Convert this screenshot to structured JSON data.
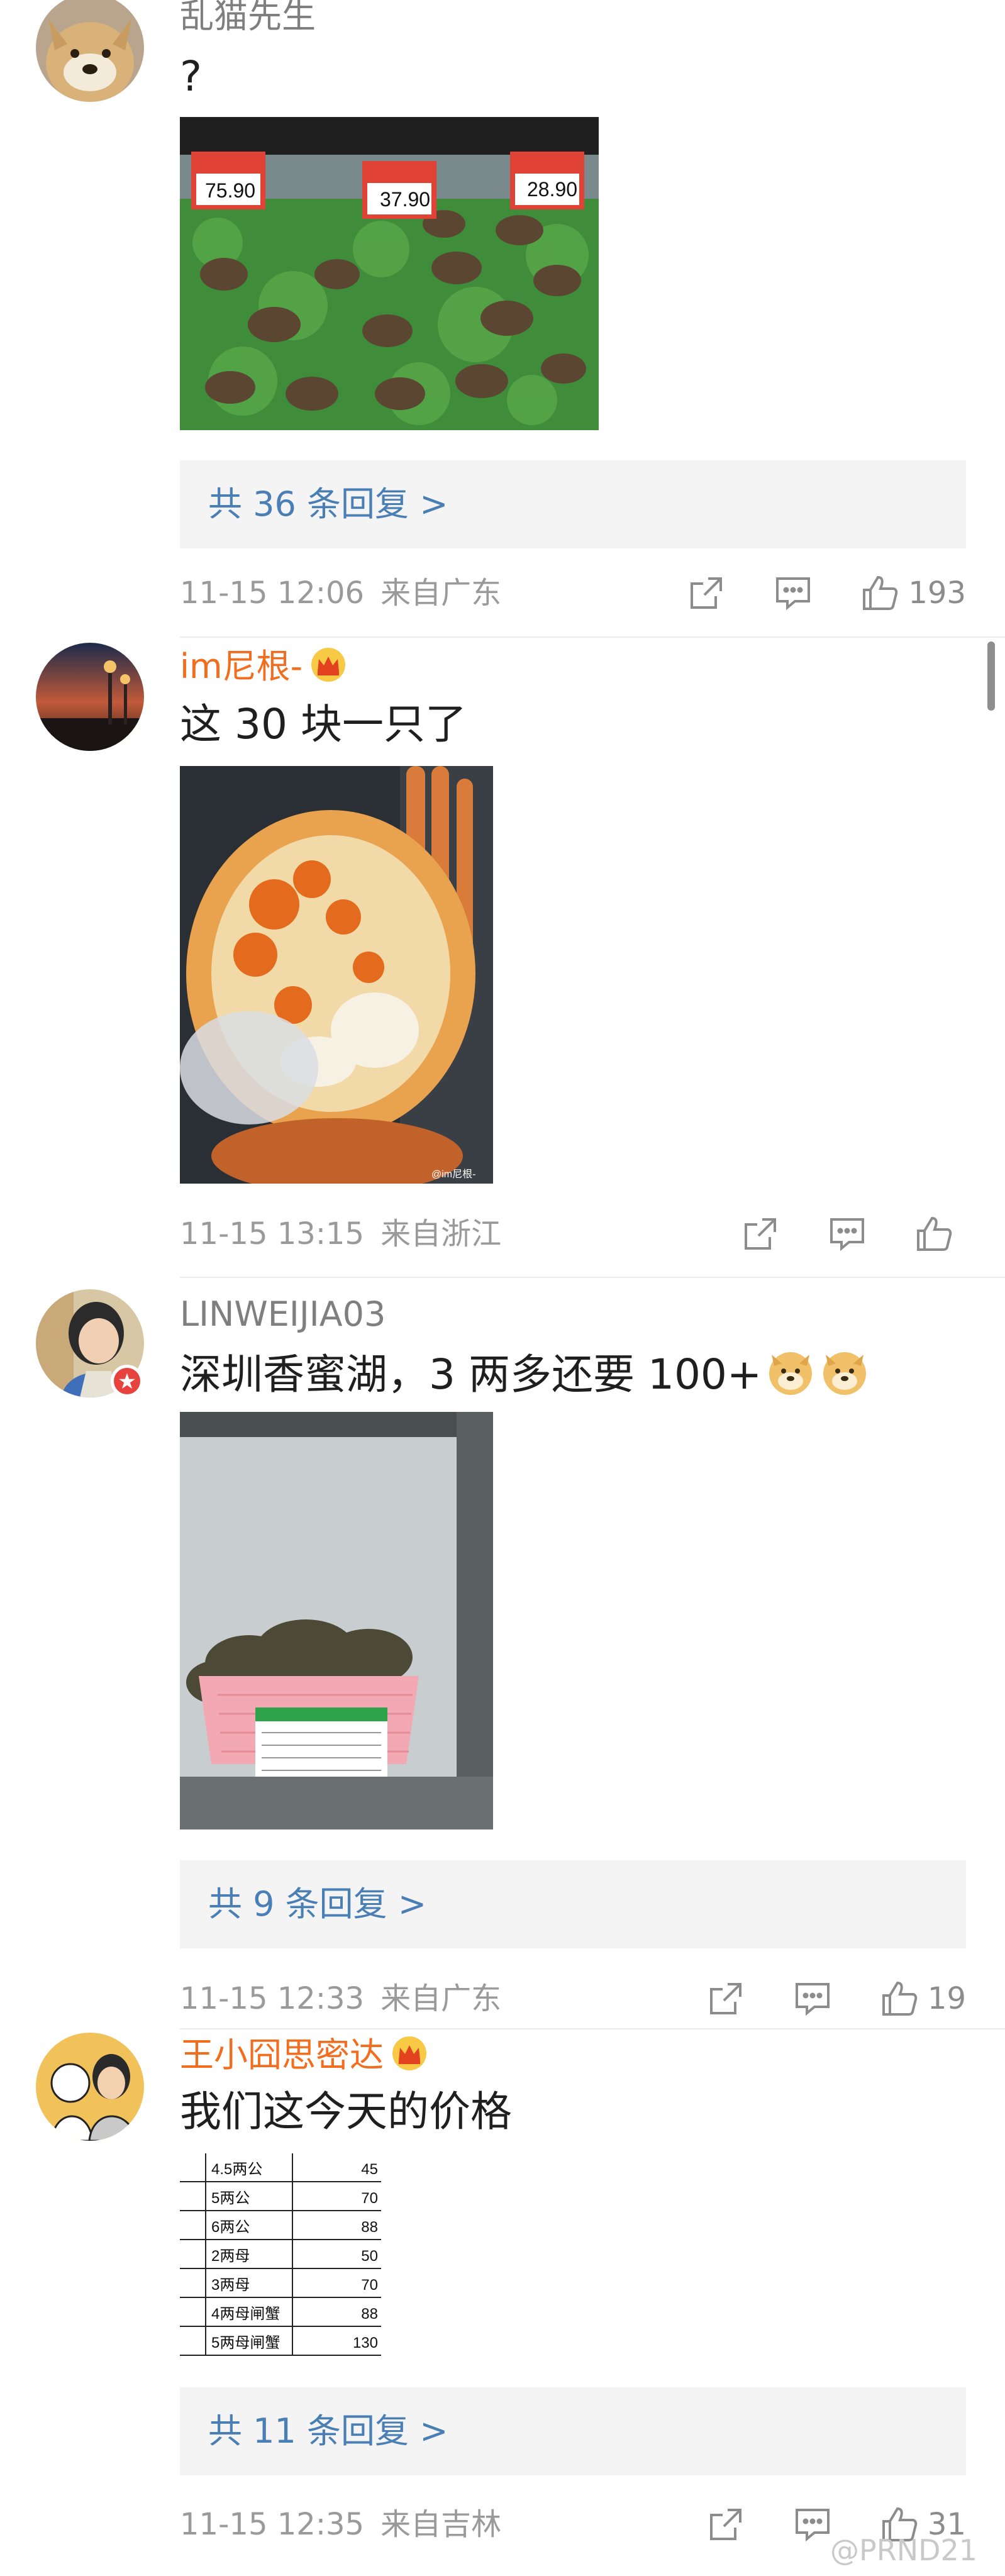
{
  "comments": [
    {
      "username": "乱猫先生",
      "text": "?",
      "replies": "共 36 条回复 >",
      "date": "11-15 12:06",
      "location": "来自广东",
      "likes": "193"
    },
    {
      "username": "im尼根-",
      "text": "这 30 块一只了",
      "photo_watermark": "@im尼根-",
      "date": "11-15 13:15",
      "location": "来自浙江",
      "likes": ""
    },
    {
      "username": "LINWEIJIA03",
      "text": "深圳香蜜湖，3 两多还要 100+",
      "replies": "共 9 条回复 >",
      "date": "11-15 12:33",
      "location": "来自广东",
      "likes": "19"
    },
    {
      "username": "王小囧思密达",
      "text": "我们这今天的价格",
      "price_rows": [
        {
          "name": "4.5两公",
          "price": "45"
        },
        {
          "name": "5两公",
          "price": "70"
        },
        {
          "name": "6两公",
          "price": "88"
        },
        {
          "name": "2两母",
          "price": "50"
        },
        {
          "name": "3两母",
          "price": "70"
        },
        {
          "name": "4两母闸蟹",
          "price": "88"
        },
        {
          "name": "5两母闸蟹",
          "price": "130"
        }
      ],
      "replies": "共 11 条回复 >",
      "date": "11-15 12:35",
      "location": "来自吉林",
      "likes": "31"
    }
  ],
  "price_tags": [
    "75.90",
    "37.90",
    "28.90"
  ],
  "watermark": "@PRND21",
  "colors": {
    "link_blue": "#4a7fb5",
    "vip_orange": "#f26e1e",
    "meta_gray": "#9a9a9a",
    "reply_bg": "#f4f4f4"
  }
}
